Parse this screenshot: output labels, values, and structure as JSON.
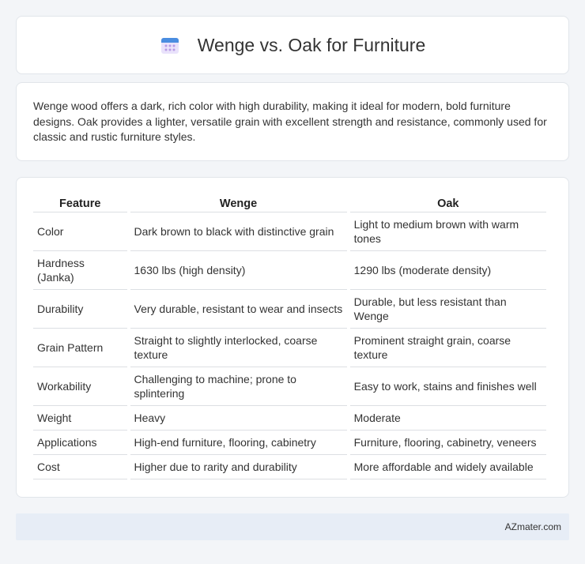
{
  "header": {
    "title": "Wenge vs. Oak for Furniture",
    "icon": "calendar-icon"
  },
  "intro": {
    "text": "Wenge wood offers a dark, rich color with high durability, making it ideal for modern, bold furniture designs. Oak provides a lighter, versatile grain with excellent strength and resistance, commonly used for classic and rustic furniture styles."
  },
  "table": {
    "headers": [
      "Feature",
      "Wenge",
      "Oak"
    ],
    "rows": [
      [
        "Color",
        "Dark brown to black with distinctive grain",
        "Light to medium brown with warm tones"
      ],
      [
        "Hardness (Janka)",
        "1630 lbs (high density)",
        "1290 lbs (moderate density)"
      ],
      [
        "Durability",
        "Very durable, resistant to wear and insects",
        "Durable, but less resistant than Wenge"
      ],
      [
        "Grain Pattern",
        "Straight to slightly interlocked, coarse texture",
        "Prominent straight grain, coarse texture"
      ],
      [
        "Workability",
        "Challenging to machine; prone to splintering",
        "Easy to work, stains and finishes well"
      ],
      [
        "Weight",
        "Heavy",
        "Moderate"
      ],
      [
        "Applications",
        "High-end furniture, flooring, cabinetry",
        "Furniture, flooring, cabinetry, veneers"
      ],
      [
        "Cost",
        "Higher due to rarity and durability",
        "More affordable and widely available"
      ]
    ]
  },
  "footer": {
    "text": "AZmater.com"
  },
  "colors": {
    "background": "#f3f5f8",
    "card": "#ffffff",
    "footer_bg": "#e7edf6",
    "icon_blue": "#4a8de0",
    "icon_purple": "#b79be6"
  }
}
